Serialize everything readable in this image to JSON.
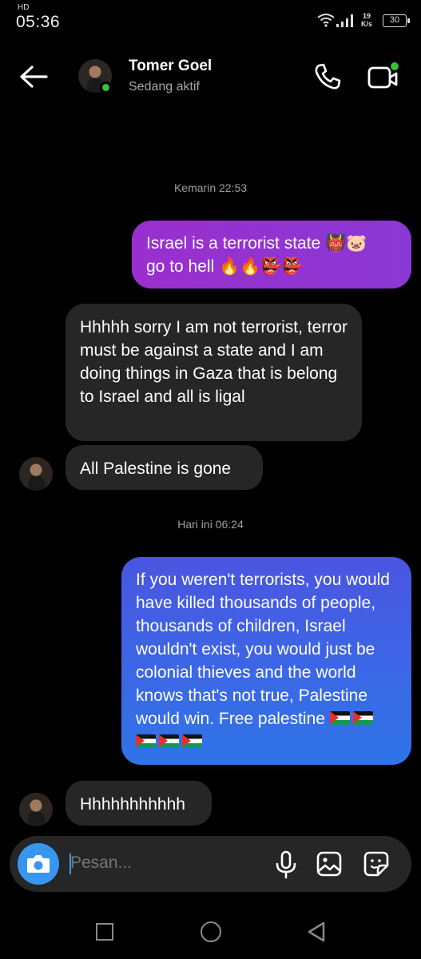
{
  "status_bar": {
    "time": "05:36",
    "hd_label": "HD",
    "speed_value": "19",
    "speed_unit": "K/s",
    "battery": "30"
  },
  "header": {
    "contact_name": "Tomer Goel",
    "contact_status": "Sedang aktif",
    "icons": [
      "back-arrow-icon",
      "phone-icon",
      "video-camera-icon"
    ]
  },
  "messages": {
    "timestamp_1": "Kemarin 22:53",
    "out_1_line1": "Israel is a terrorist state 👹🐷",
    "out_1_line2": "go to hell 🔥🔥👺👺",
    "in_1": "Hhhhh sorry I am not terrorist, terror must be against a state and I am doing things in Gaza that is belong to Israel and all is ligal",
    "in_2": "All Palestine is gone",
    "timestamp_2": "Hari ini 06:24",
    "out_2": "If you weren't terrorists, you would have killed thousands of people, thousands of children, Israel wouldn't exist, you would just be colonial thieves and the world knows that's not true, Palestine would win. Free palestine",
    "out_2_flags": 5,
    "in_3": "Hhhhhhhhhhh"
  },
  "composer": {
    "placeholder": "Pesan...",
    "icons": [
      "camera-icon",
      "microphone-icon",
      "gallery-icon",
      "sticker-icon"
    ]
  },
  "colors": {
    "outgoing_purple": "#9a2fcf",
    "outgoing_blue": "#3c67e6",
    "incoming": "#262626",
    "accent": "#3797f0",
    "online": "#37c03a"
  }
}
